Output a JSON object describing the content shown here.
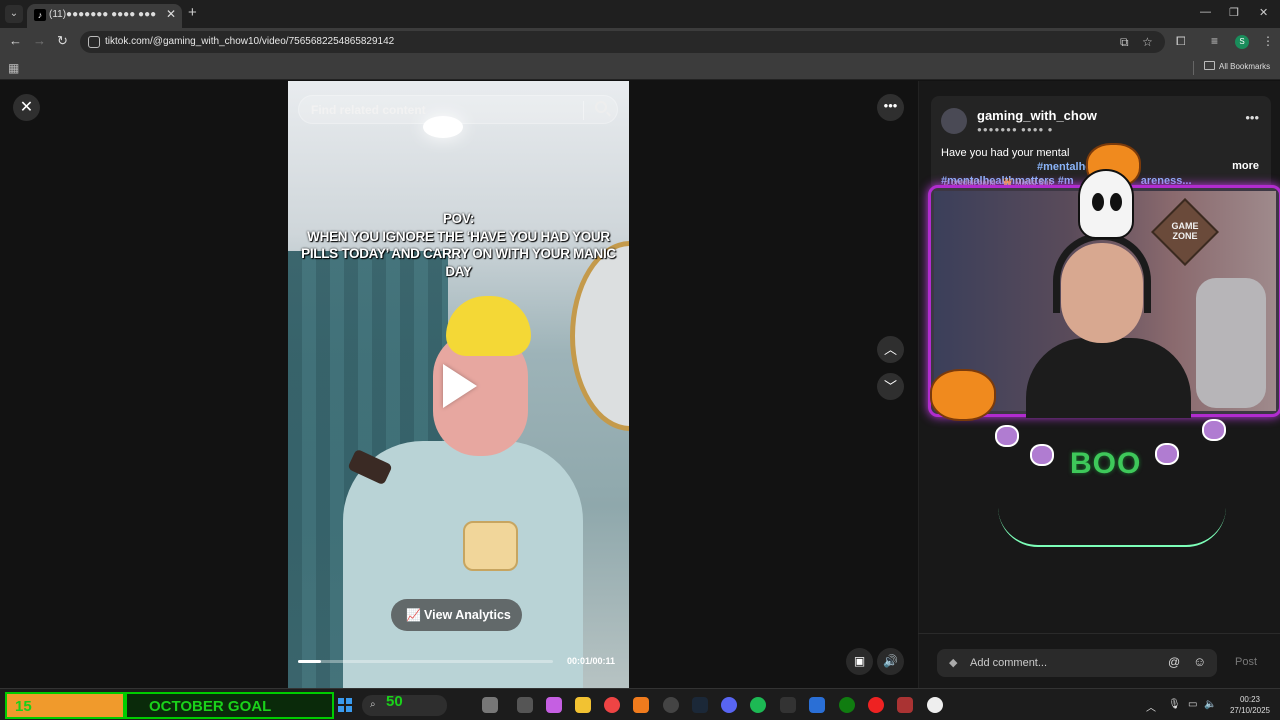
{
  "browser": {
    "tab_title": "(11)●●●●●●● ●●●● ●●●",
    "tab_favicon": "♪",
    "new_tab": "+",
    "url": "tiktok.com/@gaming_with_chow10/video/7565682254865829142",
    "bookmarks_label": "All Bookmarks",
    "profile_initial": "S"
  },
  "video": {
    "search_placeholder": "Find related content",
    "caption": "POV:\nWHEN YOU IGNORE THE ‘HAVE YOU HAD YOUR PILLS TODAY’ AND CARRY ON WITH YOUR MANIC DAY",
    "analytics_label": "View Analytics",
    "time": "00:01/00:11",
    "progress": 0.09
  },
  "post": {
    "username": "gaming_with_chow",
    "nickname": "●●●●●●● ●●●● ●",
    "description_text": "Have you had your mental",
    "hashtag1": "#mentalhealth",
    "hashtag2": "#mentalhealthmatters",
    "hashtag3": "#m",
    "hashtag4": "areness...",
    "more_label": "more",
    "music": "♫ oredalt bang - 👑 Matild Suk"
  },
  "overlay": {
    "game_zone": "GAME ZONE",
    "boo": "BOO"
  },
  "comments": {
    "placeholder": "Add comment...",
    "post_label": "Post"
  },
  "taskbar": {
    "goal_count": "15",
    "goal_label": "OCTOBER GOAL",
    "goal_number": "50",
    "time": "00:23",
    "date": "27/10/2025"
  },
  "colors": {
    "accent_hashtag": "#8ab4f8",
    "goal_green": "#1ad11a",
    "goal_orange": "#f09a2c",
    "cam_border": "#b12ccf"
  },
  "icons": [
    "close-icon",
    "search-icon",
    "more-icon",
    "chevron-up-icon",
    "chevron-down-icon",
    "volume-icon",
    "analytics-icon",
    "at-icon",
    "emoji-icon"
  ]
}
